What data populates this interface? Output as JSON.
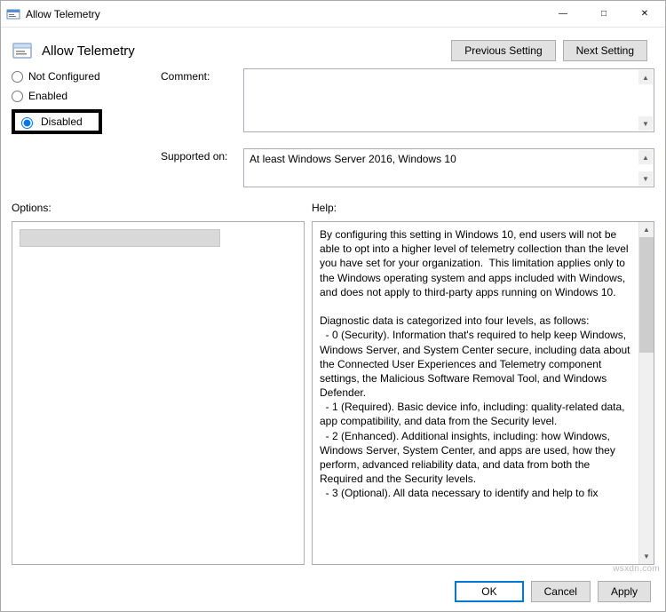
{
  "titlebar": {
    "title": "Allow Telemetry"
  },
  "header": {
    "title": "Allow Telemetry",
    "prev_btn": "Previous Setting",
    "next_btn": "Next Setting"
  },
  "state": {
    "not_configured": "Not Configured",
    "enabled": "Enabled",
    "disabled": "Disabled",
    "selected": "disabled"
  },
  "fields": {
    "comment_label": "Comment:",
    "comment_value": "",
    "supported_label": "Supported on:",
    "supported_value": "At least Windows Server 2016, Windows 10"
  },
  "panels": {
    "options_label": "Options:",
    "help_label": "Help:",
    "help_text": "By configuring this setting in Windows 10, end users will not be able to opt into a higher level of telemetry collection than the level you have set for your organization.  This limitation applies only to the Windows operating system and apps included with Windows, and does not apply to third-party apps running on Windows 10.\n\nDiagnostic data is categorized into four levels, as follows:\n  - 0 (Security). Information that's required to help keep Windows, Windows Server, and System Center secure, including data about the Connected User Experiences and Telemetry component settings, the Malicious Software Removal Tool, and Windows Defender.\n  - 1 (Required). Basic device info, including: quality-related data, app compatibility, and data from the Security level.\n  - 2 (Enhanced). Additional insights, including: how Windows, Windows Server, System Center, and apps are used, how they perform, advanced reliability data, and data from both the Required and the Security levels.\n  - 3 (Optional). All data necessary to identify and help to fix"
  },
  "footer": {
    "ok": "OK",
    "cancel": "Cancel",
    "apply": "Apply"
  },
  "watermark": "wsxdn.com"
}
